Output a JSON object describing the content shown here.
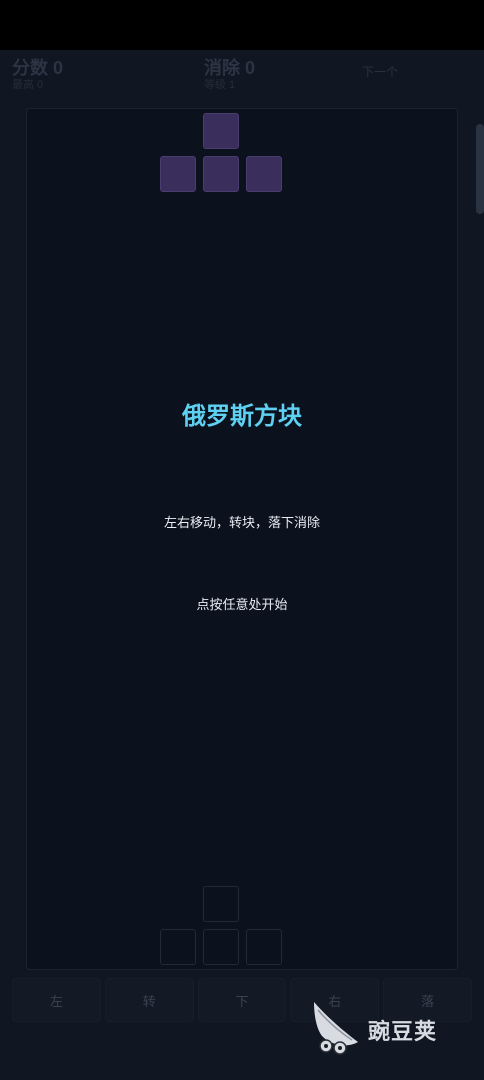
{
  "hud": {
    "score_label": "分数 0",
    "best_label": "最高 0",
    "lines_label": "消除 0",
    "level_label": "等级 1",
    "next_label": "下一个"
  },
  "overlay": {
    "title": "俄罗斯方块",
    "instructions": "左右移动，转块，落下消除",
    "start_hint": "点按任意处开始"
  },
  "controls": {
    "left": "左",
    "rotate": "转",
    "down": "下",
    "right": "右",
    "drop": "落"
  },
  "watermark": {
    "text": "豌豆荚",
    "logo": "pea-pod-logo"
  },
  "colors": {
    "background": "#111722",
    "board": "#0c121d",
    "piece": "#3a2f5c",
    "title": "#5ed1f2"
  },
  "active_piece": {
    "shape": "T",
    "icon": "t-tetromino"
  },
  "ghost_piece": {
    "shape": "T",
    "icon": "t-tetromino-ghost"
  }
}
